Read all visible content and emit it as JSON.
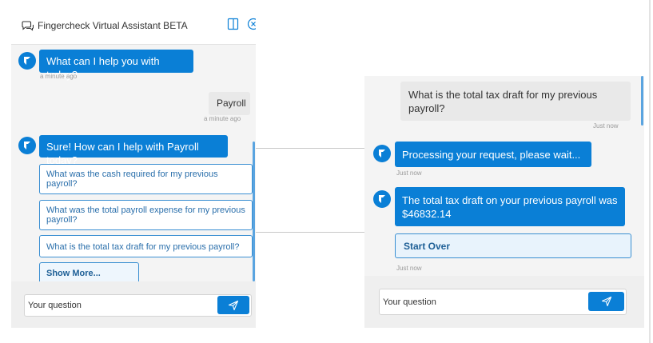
{
  "left_panel": {
    "header": {
      "title": "Fingercheck Virtual Assistant BETA"
    },
    "messages": {
      "welcome": {
        "text": "What can I help you with today?",
        "time": "a minute ago"
      },
      "user_payroll": {
        "text": "Payroll",
        "time": "a minute ago"
      },
      "bot_sure": {
        "text": "Sure! How can I help with Payroll today?"
      }
    },
    "options": [
      {
        "label": "What was the cash required for my previous payroll?"
      },
      {
        "label": "What was the total payroll expense for my previous payroll?"
      },
      {
        "label": "What is the total tax draft for my previous payroll?"
      }
    ],
    "show_more_label": "Show More...",
    "input_placeholder": "Your question"
  },
  "right_panel": {
    "user_question": {
      "text": "What is the total tax draft for my previous payroll?",
      "time": "Just now"
    },
    "processing": {
      "text": "Processing your request, please wait...",
      "time": "Just now"
    },
    "result": {
      "text": "The total tax draft on your previous payroll was $46832.14"
    },
    "start_over_label": "Start Over",
    "result_time": "Just now",
    "input_placeholder": "Your question"
  },
  "colors": {
    "accent": "#0a7fd6",
    "panel_bg": "#f4f4f4",
    "user_bubble": "#e9e9e9"
  },
  "icons": [
    "chat-icon",
    "expand-icon",
    "close-icon",
    "bot-avatar-icon",
    "send-icon"
  ]
}
